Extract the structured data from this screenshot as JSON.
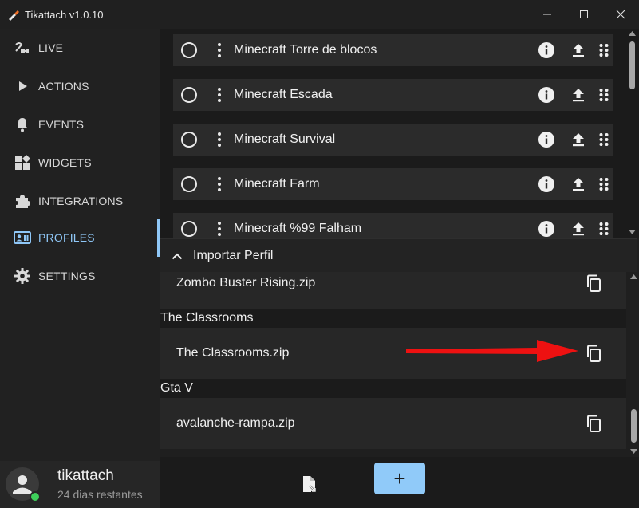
{
  "window": {
    "title": "Tikattach v1.0.10"
  },
  "sidebar": {
    "items": [
      {
        "label": "LIVE",
        "icon": "live-icon",
        "active": false
      },
      {
        "label": "ACTIONS",
        "icon": "play-icon",
        "active": false
      },
      {
        "label": "EVENTS",
        "icon": "bell-icon",
        "active": false
      },
      {
        "label": "WIDGETS",
        "icon": "widgets-icon",
        "active": false
      },
      {
        "label": "INTEGRATIONS",
        "icon": "puzzle-icon",
        "active": false
      },
      {
        "label": "PROFILES",
        "icon": "profile-card-icon",
        "active": true
      },
      {
        "label": "SETTINGS",
        "icon": "gear-icon",
        "active": false
      }
    ],
    "accent_color": "#8fc7f7"
  },
  "user": {
    "name": "tikattach",
    "subtitle": "24 dias restantes",
    "status_color": "#3ecf5a"
  },
  "profiles": [
    {
      "name": "Minecraft Torre de blocos"
    },
    {
      "name": "Minecraft Escada"
    },
    {
      "name": "Minecraft Survival"
    },
    {
      "name": "Minecraft Farm"
    },
    {
      "name": "Minecraft %99 Falham"
    }
  ],
  "import_panel": {
    "title": "Importar Perfil",
    "groups": [
      {
        "title": "",
        "files": [
          "Zombo Buster Rising.zip"
        ]
      },
      {
        "title": "The Classrooms",
        "files": [
          "The Classrooms.zip"
        ]
      },
      {
        "title": "Gta V",
        "files": [
          "avalanche-rampa.zip"
        ]
      }
    ]
  },
  "annotation": {
    "arrow_color": "#ee1111"
  },
  "footer": {
    "add_label": "+",
    "add_color": "#90caf9"
  }
}
